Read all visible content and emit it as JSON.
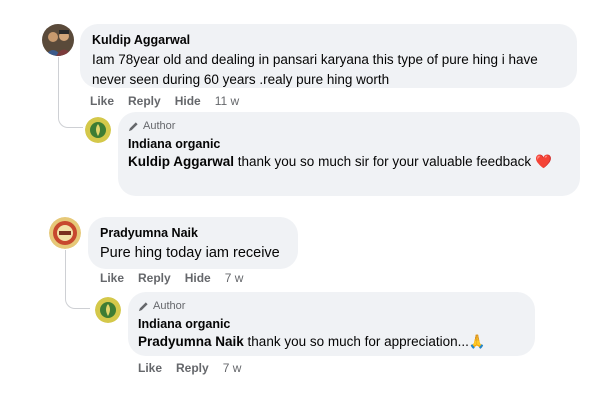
{
  "comments": [
    {
      "author": "Kuldip Aggarwal",
      "text": "Iam 78year old and dealing in pansari karyana this type of pure hing i have never seen during 60 years .realy pure hing worth",
      "actions": {
        "like": "Like",
        "reply": "Reply",
        "hide": "Hide",
        "time": "11 w"
      },
      "reply": {
        "badge": "Author",
        "page_name": "Indiana organic",
        "mention": "Kuldip Aggarwal",
        "text": " thank you so much sir for your valuable feedback",
        "emoji": "❤️"
      }
    },
    {
      "author": "Pradyumna Naik",
      "text": "Pure hing today iam receive",
      "actions": {
        "like": "Like",
        "reply": "Reply",
        "hide": "Hide",
        "time": "7 w"
      },
      "reply": {
        "badge": "Author",
        "page_name": "Indiana organic",
        "mention": "Pradyumna Naik",
        "text": " thank you so much for appreciation...",
        "emoji": "🙏",
        "actions": {
          "like": "Like",
          "reply": "Reply",
          "time": "7 w"
        }
      }
    }
  ],
  "colors": {
    "bubble": "#f0f2f5",
    "meta_text": "#65676b",
    "heart": "#e41e3f",
    "brand_avatar": "#d4c84a"
  },
  "icons": [
    "user-avatar",
    "brand-logo-avatar",
    "pencil-icon",
    "heart-emoji",
    "folded-hands-emoji"
  ]
}
